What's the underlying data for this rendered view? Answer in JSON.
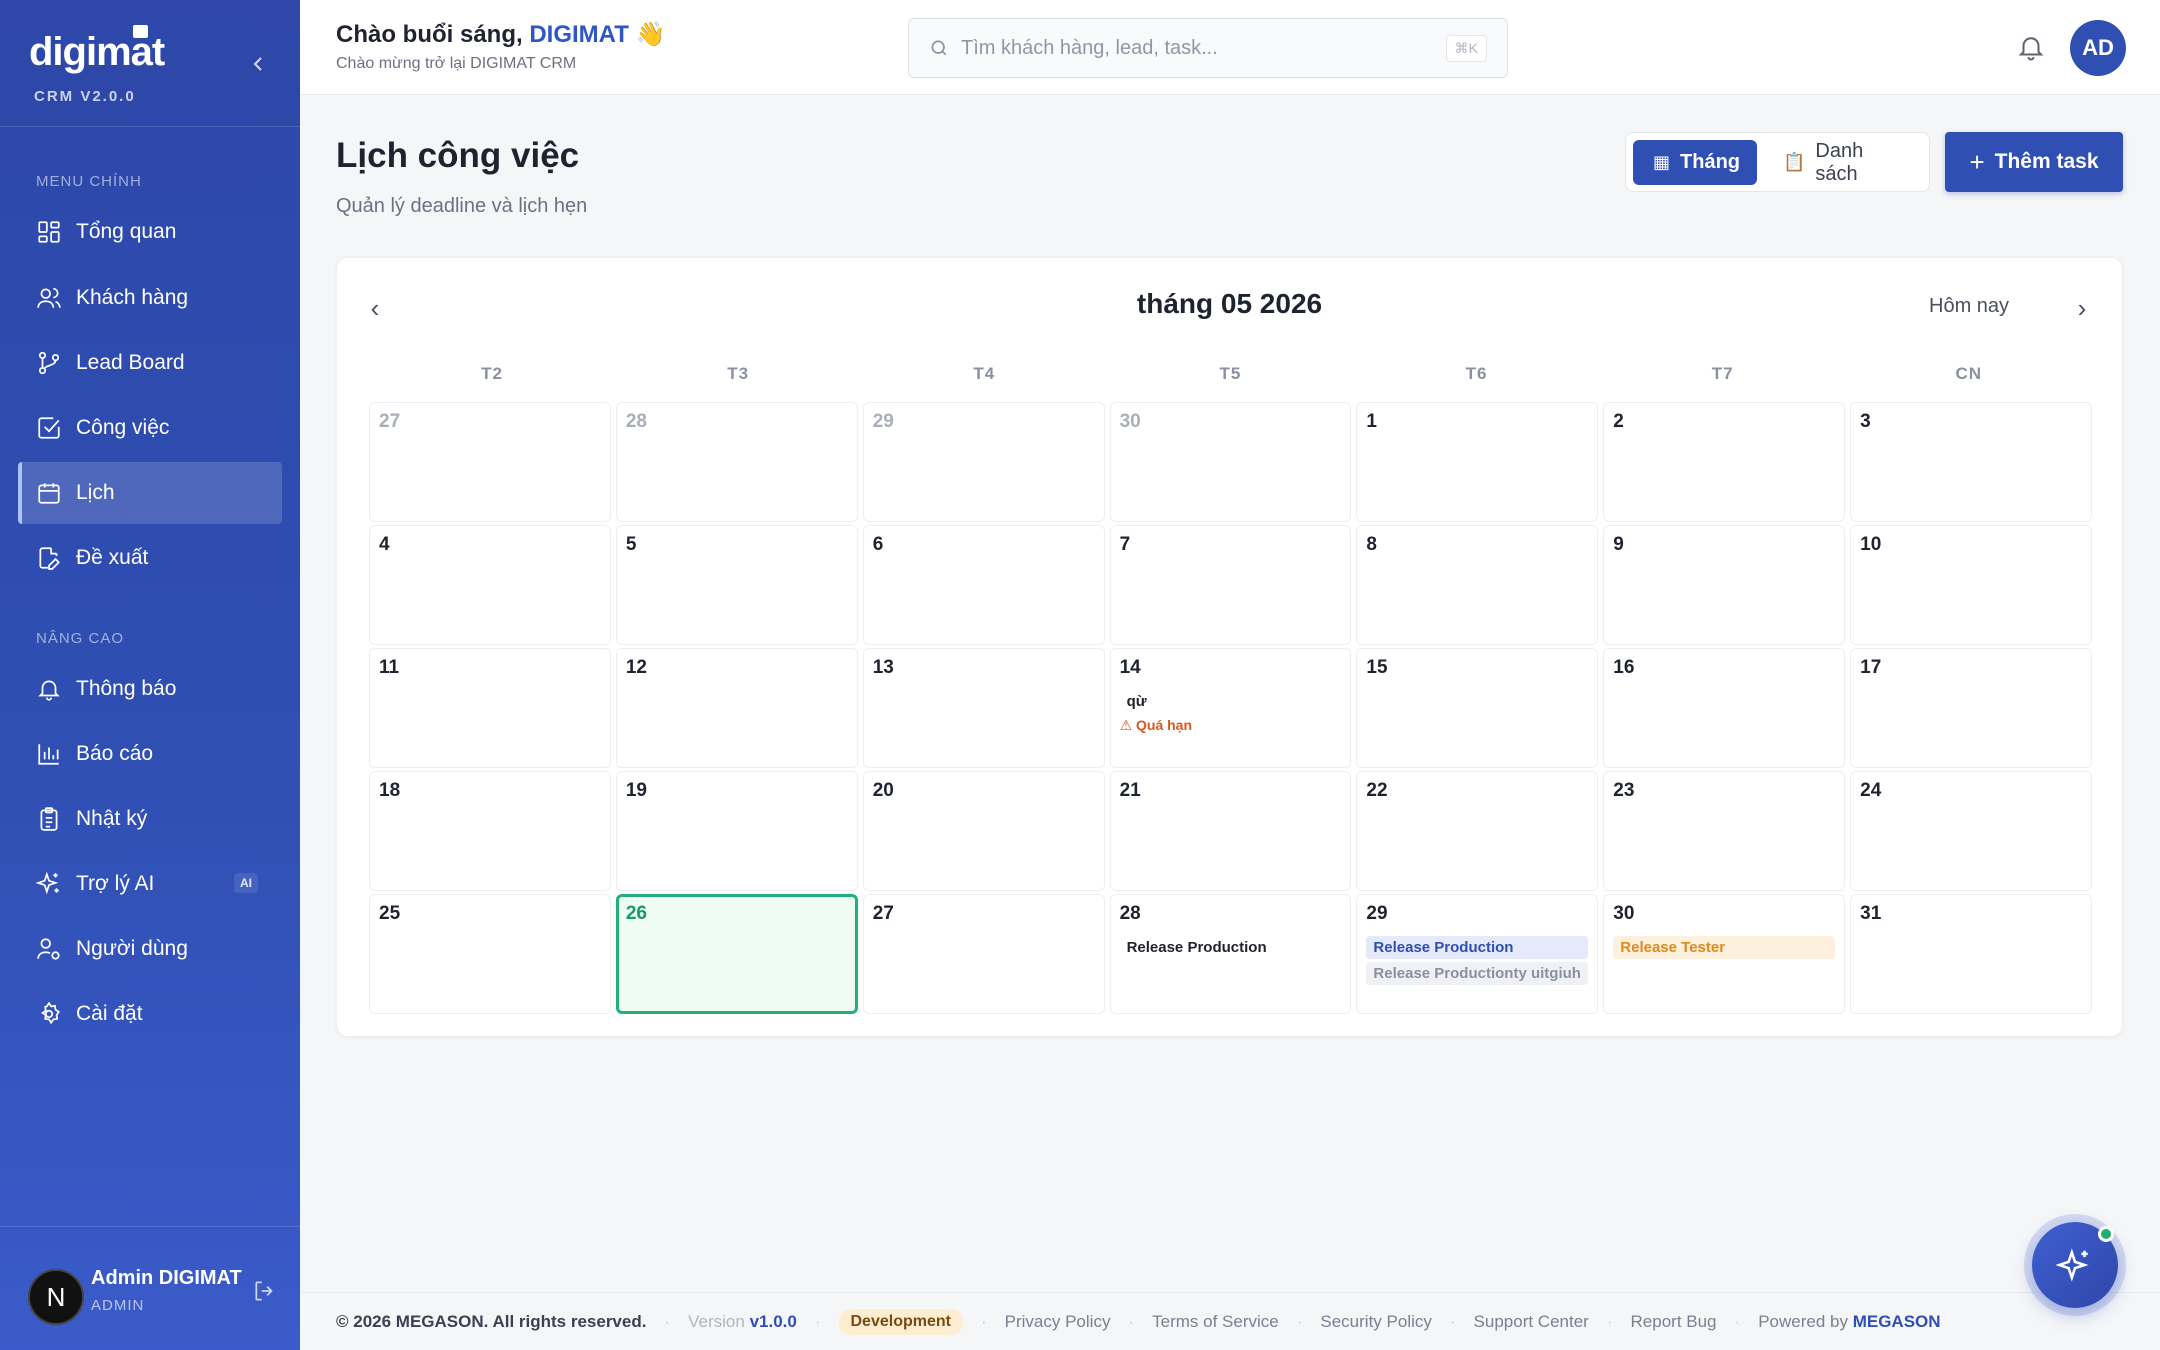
{
  "brand": {
    "logo": "digimat",
    "version": "CRM V2.0.0"
  },
  "sidebar": {
    "section_main": "MENU CHÍNH",
    "section_advanced": "NÂNG CAO",
    "items": [
      {
        "label": "Tổng quan",
        "icon": "grid-icon"
      },
      {
        "label": "Khách hàng",
        "icon": "users-icon"
      },
      {
        "label": "Lead Board",
        "icon": "git-branch-icon"
      },
      {
        "label": "Công việc",
        "icon": "check-square-icon"
      },
      {
        "label": "Lịch",
        "icon": "calendar-icon",
        "active": true
      },
      {
        "label": "Đề xuất",
        "icon": "file-edit-icon"
      },
      {
        "label": "Thông báo",
        "icon": "bell-icon"
      },
      {
        "label": "Báo cáo",
        "icon": "bar-chart-icon"
      },
      {
        "label": "Nhật ký",
        "icon": "clipboard-icon"
      },
      {
        "label": "Trợ lý AI",
        "icon": "sparkle-icon",
        "badge": "AI"
      },
      {
        "label": "Người dùng",
        "icon": "user-cog-icon"
      },
      {
        "label": "Cài đặt",
        "icon": "gear-icon"
      }
    ],
    "user": {
      "avatar": "N",
      "name": "Admin DIGIMAT",
      "role": "ADMIN"
    }
  },
  "header": {
    "greeting": "Chào buổi sáng,",
    "greeting_name": "DIGIMAT",
    "greeting_emoji": "👋",
    "subtitle": "Chào mừng trở lại DIGIMAT CRM",
    "search_placeholder": "Tìm khách hàng, lead, task...",
    "search_shortcut": "⌘K",
    "avatar": "AD"
  },
  "page": {
    "title": "Lịch công việc",
    "subtitle": "Quản lý deadline và lịch hẹn",
    "view_month": "Tháng",
    "view_list": "Danh sách",
    "add_task": "Thêm task"
  },
  "calendar": {
    "month_title": "tháng 05 2026",
    "today_label": "Hôm nay",
    "weekdays": [
      "T2",
      "T3",
      "T4",
      "T5",
      "T6",
      "T7",
      "CN"
    ],
    "days": [
      {
        "n": "27",
        "other": true
      },
      {
        "n": "28",
        "other": true
      },
      {
        "n": "29",
        "other": true
      },
      {
        "n": "30",
        "other": true
      },
      {
        "n": "1"
      },
      {
        "n": "2"
      },
      {
        "n": "3"
      },
      {
        "n": "4"
      },
      {
        "n": "5"
      },
      {
        "n": "6"
      },
      {
        "n": "7"
      },
      {
        "n": "8"
      },
      {
        "n": "9"
      },
      {
        "n": "10"
      },
      {
        "n": "11"
      },
      {
        "n": "12"
      },
      {
        "n": "13"
      },
      {
        "n": "14",
        "events": [
          {
            "text": "qừ",
            "style": "plain"
          },
          {
            "text": "⚠ Quá hạn",
            "style": "overdue"
          }
        ]
      },
      {
        "n": "15"
      },
      {
        "n": "16"
      },
      {
        "n": "17"
      },
      {
        "n": "18"
      },
      {
        "n": "19"
      },
      {
        "n": "20"
      },
      {
        "n": "21"
      },
      {
        "n": "22"
      },
      {
        "n": "23"
      },
      {
        "n": "24"
      },
      {
        "n": "25"
      },
      {
        "n": "26",
        "today": true
      },
      {
        "n": "27"
      },
      {
        "n": "28",
        "events": [
          {
            "text": "Release Production",
            "style": "plain"
          }
        ]
      },
      {
        "n": "29",
        "events": [
          {
            "text": "Release Production",
            "style": "blue"
          },
          {
            "text": "Release Productionty uitgiuh",
            "style": "gray"
          }
        ]
      },
      {
        "n": "30",
        "events": [
          {
            "text": "Release Tester",
            "style": "orange"
          }
        ]
      },
      {
        "n": "31"
      }
    ]
  },
  "footer": {
    "copyright": "© 2026 MEGASON. All rights reserved.",
    "version_label": "Version",
    "version": "v1.0.0",
    "env": "Development",
    "links": [
      "Privacy Policy",
      "Terms of Service",
      "Security Policy",
      "Support Center",
      "Report Bug"
    ],
    "powered_label": "Powered by",
    "powered_brand": "MEGASON"
  },
  "colors": {
    "primary": "#2f4fb3",
    "today": "#22b07a",
    "overdue": "#d9571f",
    "tester": "#e08a1c"
  }
}
